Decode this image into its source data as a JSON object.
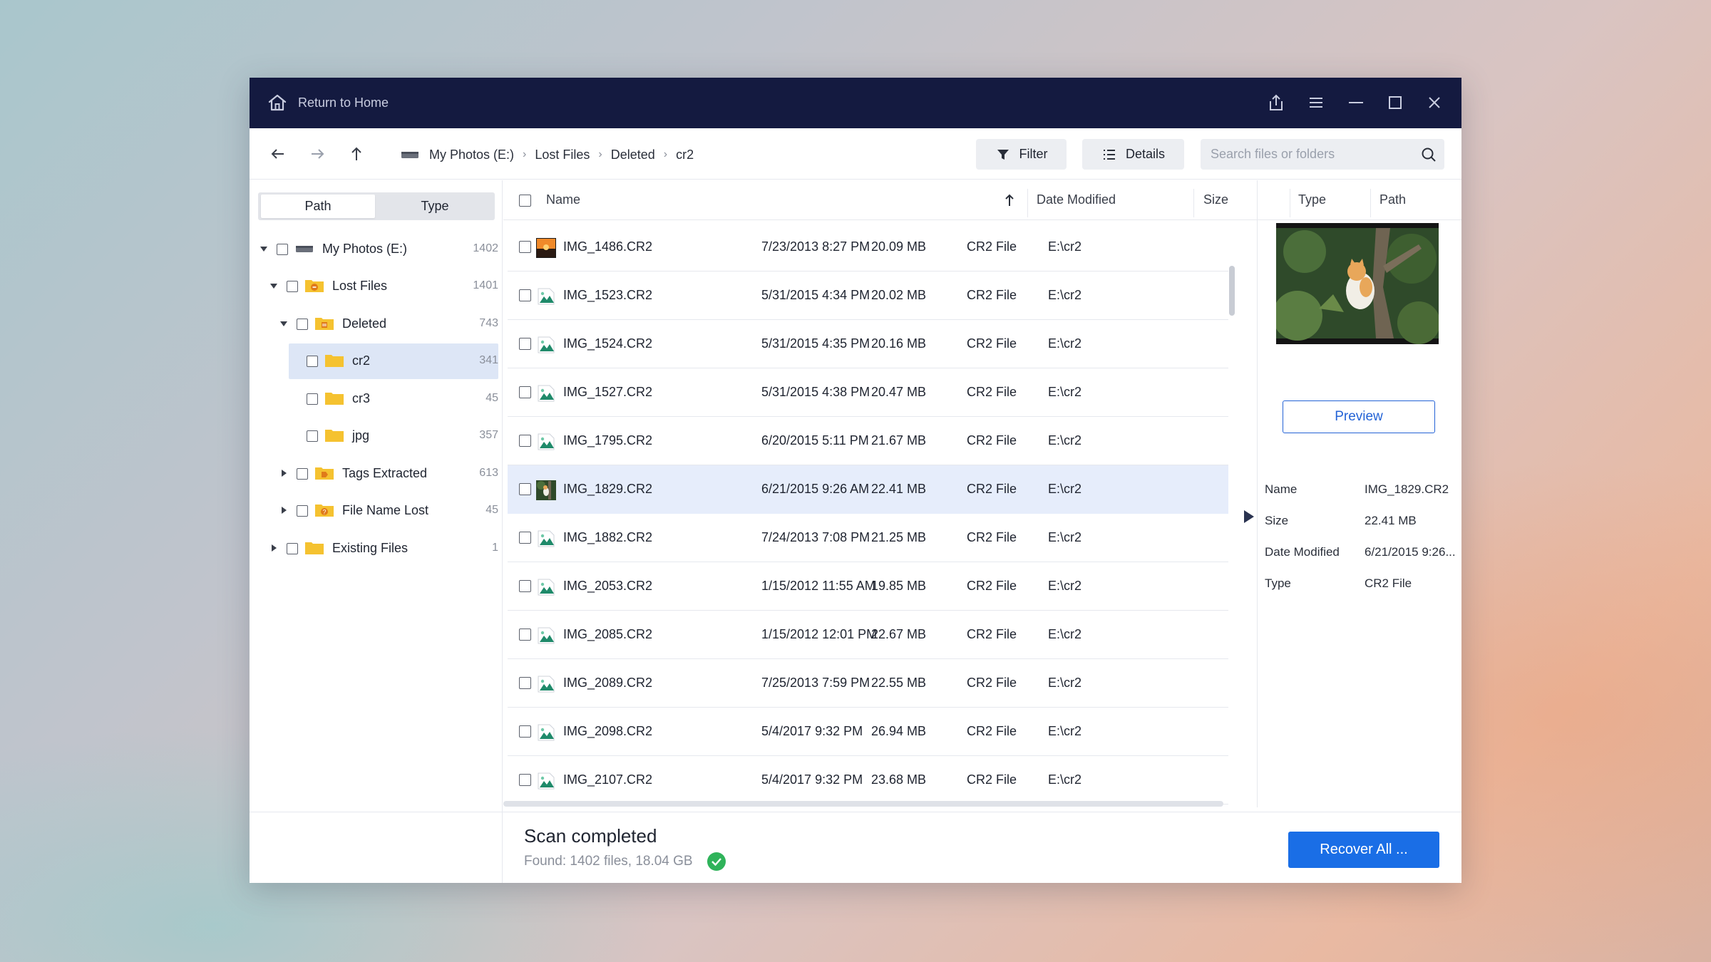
{
  "window": {
    "title": "Return to Home"
  },
  "breadcrumb": [
    "My Photos (E:)",
    "Lost Files",
    "Deleted",
    "cr2"
  ],
  "toolbar": {
    "filter_label": "Filter",
    "details_label": "Details"
  },
  "search": {
    "placeholder": "Search files or folders"
  },
  "sidebar": {
    "tabs": [
      "Path",
      "Type"
    ],
    "tree": [
      {
        "label": "My Photos (E:)",
        "count": "1402",
        "icon": "drive-icon",
        "expanded": true
      },
      {
        "label": "Lost Files",
        "count": "1401",
        "icon": "folder-lost-icon",
        "expanded": true
      },
      {
        "label": "Deleted",
        "count": "743",
        "icon": "folder-deleted-icon",
        "expanded": true
      },
      {
        "label": "cr2",
        "count": "341",
        "icon": "folder-icon",
        "selected": true
      },
      {
        "label": "cr3",
        "count": "45",
        "icon": "folder-icon"
      },
      {
        "label": "jpg",
        "count": "357",
        "icon": "folder-icon"
      },
      {
        "label": "Tags Extracted",
        "count": "613",
        "icon": "folder-tag-icon",
        "expanded": false
      },
      {
        "label": "File Name Lost",
        "count": "45",
        "icon": "folder-question-icon",
        "expanded": false
      },
      {
        "label": "Existing Files",
        "count": "1",
        "icon": "folder-icon",
        "expanded": false
      }
    ]
  },
  "table": {
    "columns": [
      "Name",
      "Date Modified",
      "Size",
      "Type",
      "Path"
    ],
    "rows": [
      {
        "name": "IMG_1486.CR2",
        "date": "7/23/2013 8:27 PM",
        "size": "20.09 MB",
        "type": "CR2 File",
        "path": "E:\\cr2",
        "icon": "sunset-thumbnail-icon"
      },
      {
        "name": "IMG_1523.CR2",
        "date": "5/31/2015 4:34 PM",
        "size": "20.02 MB",
        "type": "CR2 File",
        "path": "E:\\cr2",
        "icon": "image-file-icon"
      },
      {
        "name": "IMG_1524.CR2",
        "date": "5/31/2015 4:35 PM",
        "size": "20.16 MB",
        "type": "CR2 File",
        "path": "E:\\cr2",
        "icon": "image-file-icon"
      },
      {
        "name": "IMG_1527.CR2",
        "date": "5/31/2015 4:38 PM",
        "size": "20.47 MB",
        "type": "CR2 File",
        "path": "E:\\cr2",
        "icon": "image-file-icon"
      },
      {
        "name": "IMG_1795.CR2",
        "date": "6/20/2015 5:11 PM",
        "size": "21.67 MB",
        "type": "CR2 File",
        "path": "E:\\cr2",
        "icon": "image-file-icon"
      },
      {
        "name": "IMG_1829.CR2",
        "date": "6/21/2015 9:26 AM",
        "size": "22.41 MB",
        "type": "CR2 File",
        "path": "E:\\cr2",
        "icon": "cat-thumbnail-icon",
        "selected": true
      },
      {
        "name": "IMG_1882.CR2",
        "date": "7/24/2013 7:08 PM",
        "size": "21.25 MB",
        "type": "CR2 File",
        "path": "E:\\cr2",
        "icon": "image-file-icon"
      },
      {
        "name": "IMG_2053.CR2",
        "date": "1/15/2012 11:55 AM",
        "size": "19.85 MB",
        "type": "CR2 File",
        "path": "E:\\cr2",
        "icon": "image-file-icon"
      },
      {
        "name": "IMG_2085.CR2",
        "date": "1/15/2012 12:01 PM",
        "size": "22.67 MB",
        "type": "CR2 File",
        "path": "E:\\cr2",
        "icon": "image-file-icon"
      },
      {
        "name": "IMG_2089.CR2",
        "date": "7/25/2013 7:59 PM",
        "size": "22.55 MB",
        "type": "CR2 File",
        "path": "E:\\cr2",
        "icon": "image-file-icon"
      },
      {
        "name": "IMG_2098.CR2",
        "date": "5/4/2017 9:32 PM",
        "size": "26.94 MB",
        "type": "CR2 File",
        "path": "E:\\cr2",
        "icon": "image-file-icon"
      },
      {
        "name": "IMG_2107.CR2",
        "date": "5/4/2017 9:32 PM",
        "size": "23.68 MB",
        "type": "CR2 File",
        "path": "E:\\cr2",
        "icon": "image-file-icon"
      }
    ]
  },
  "details": {
    "preview_label": "Preview",
    "props": [
      {
        "key": "Name",
        "value": "IMG_1829.CR2"
      },
      {
        "key": "Size",
        "value": "22.41 MB"
      },
      {
        "key": "Date Modified",
        "value": "6/21/2015 9:26..."
      },
      {
        "key": "Type",
        "value": "CR2 File"
      }
    ]
  },
  "footer": {
    "status_title": "Scan completed",
    "status_sub": "Found: 1402 files, 18.04 GB",
    "recover_label": "Recover All ..."
  },
  "colors": {
    "titlebar": "#141a40",
    "accent": "#1a6ee6",
    "selected_row": "#e6edfb",
    "success": "#2fb35a",
    "folder": "#f5c230"
  }
}
